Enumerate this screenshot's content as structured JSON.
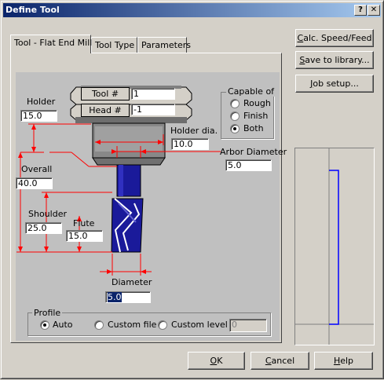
{
  "window": {
    "title": "Define Tool",
    "help_btn": "?",
    "close_btn": "X"
  },
  "tabs": [
    {
      "label": "Tool - Flat End Mill",
      "active": true
    },
    {
      "label": "Tool Type",
      "active": false
    },
    {
      "label": "Parameters",
      "active": false
    }
  ],
  "side_buttons": {
    "calc": {
      "prefix": "",
      "underline": "C",
      "rest": "alc. Speed/Feed"
    },
    "save": {
      "prefix": "",
      "underline": "S",
      "rest": "ave to library..."
    },
    "setup": {
      "prefix": "",
      "underline": "J",
      "rest": "ob setup..."
    }
  },
  "bottom_buttons": {
    "ok": {
      "prefix": "",
      "underline": "O",
      "rest": "K"
    },
    "cancel": {
      "prefix": "",
      "underline": "C",
      "rest": "ancel"
    },
    "help": {
      "prefix": "",
      "underline": "H",
      "rest": "elp"
    }
  },
  "fields": {
    "tool_num": {
      "label": "Tool #",
      "value": "1"
    },
    "head_num": {
      "label": "Head #",
      "value": "-1"
    },
    "holder": {
      "label": "Holder",
      "value": "15.0"
    },
    "holder_dia": {
      "label": "Holder dia.",
      "value": "10.0"
    },
    "arbor_dia": {
      "label": "Arbor Diameter",
      "value": "5.0"
    },
    "overall": {
      "label": "Overall",
      "value": "40.0"
    },
    "shoulder": {
      "label": "Shoulder",
      "value": "25.0"
    },
    "flute": {
      "label": "Flute",
      "value": "15.0"
    },
    "diameter": {
      "label": "Diameter",
      "value": "5.0"
    }
  },
  "capable_of": {
    "title": "Capable of",
    "options": [
      {
        "label": "Rough",
        "selected": false
      },
      {
        "label": "Finish",
        "selected": false
      },
      {
        "label": "Both",
        "selected": true
      }
    ]
  },
  "profile": {
    "title": "Profile",
    "options": [
      {
        "label": "Auto",
        "selected": true
      },
      {
        "label": "Custom file",
        "selected": false
      },
      {
        "label": "Custom level",
        "selected": false
      }
    ],
    "level_value": "0"
  },
  "colors": {
    "dimension_red": "#ff0000",
    "tool_blue": "#1a1a9a",
    "titlebar": "#0a246a"
  }
}
